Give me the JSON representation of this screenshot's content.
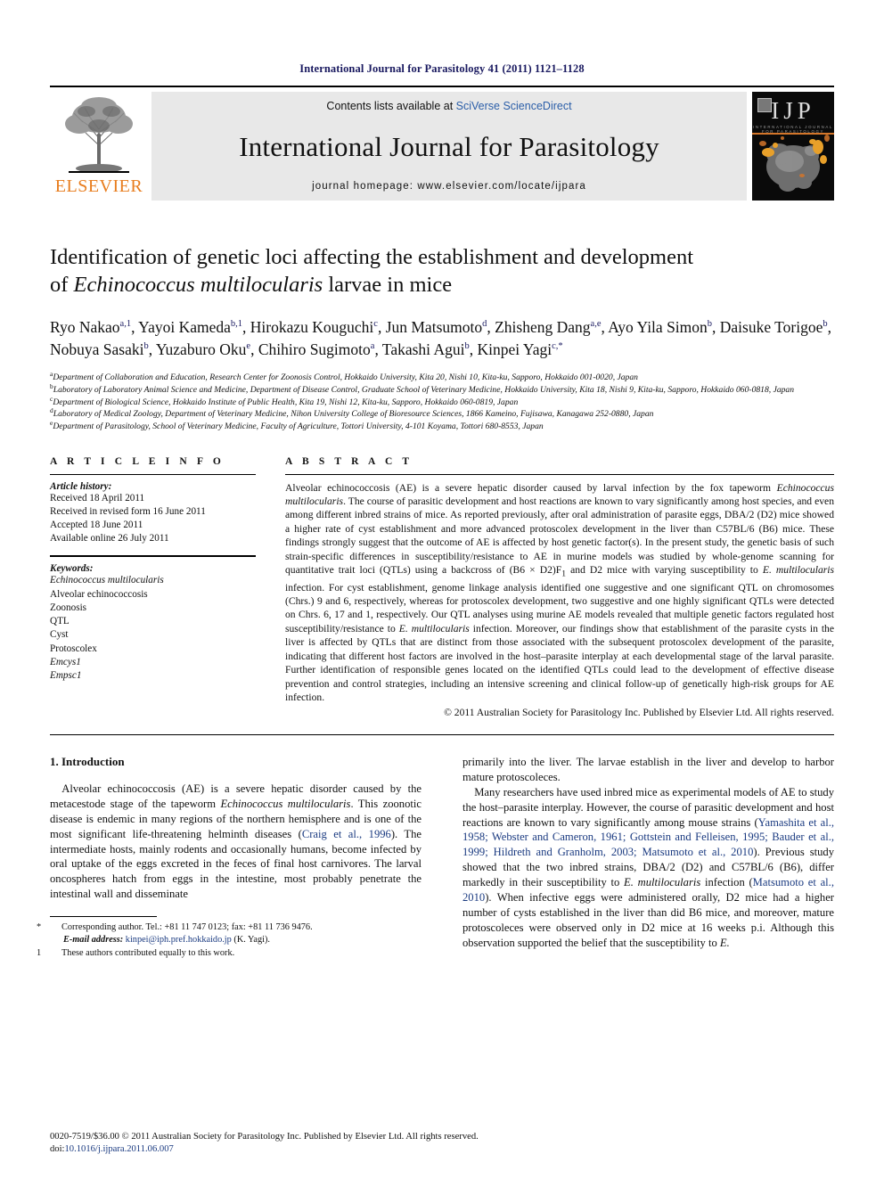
{
  "running_head": "International Journal for Parasitology 41 (2011) 1121–1128",
  "header": {
    "contents_prefix": "Contents lists available at ",
    "contents_link": "SciVerse ScienceDirect",
    "journal_title": "International Journal for Parasitology",
    "homepage_label": "journal homepage: www.elsevier.com/locate/ijpara",
    "elsevier_wordmark": "ELSEVIER",
    "cover_title": "IJP",
    "cover_subtitle": "INTERNATIONAL JOURNAL FOR PARASITOLOGY",
    "accent_color": "#e87d1e",
    "link_color": "#2b5ea8",
    "band_color": "#e8e8e8"
  },
  "article": {
    "title_line1": "Identification of genetic loci affecting the establishment and development",
    "title_line2_pre": "of ",
    "title_line2_italic": "Echinococcus multilocularis",
    "title_line2_post": " larvae in mice",
    "authors_html": "Ryo Nakao<sup>a,1</sup>, Yayoi Kameda<sup>b,1</sup>, Hirokazu Kouguchi<sup>c</sup>, Jun Matsumoto<sup>d</sup>, Zhisheng Dang<sup>a,e</sup>, Ayo Yila Simon<sup>b</sup>, Daisuke Torigoe<sup>b</sup>, Nobuya Sasaki<sup>b</sup>, Yuzaburo Oku<sup>e</sup>, Chihiro Sugimoto<sup>a</sup>, Takashi Agui<sup>b</sup>, Kinpei Yagi<sup>c,*</sup>",
    "affiliations": [
      {
        "marker": "a",
        "text": "Department of Collaboration and Education, Research Center for Zoonosis Control, Hokkaido University, Kita 20, Nishi 10, Kita-ku, Sapporo, Hokkaido 001-0020, Japan"
      },
      {
        "marker": "b",
        "text": "Laboratory of Laboratory Animal Science and Medicine, Department of Disease Control, Graduate School of Veterinary Medicine, Hokkaido University, Kita 18, Nishi 9, Kita-ku, Sapporo, Hokkaido 060-0818, Japan"
      },
      {
        "marker": "c",
        "text": "Department of Biological Science, Hokkaido Institute of Public Health, Kita 19, Nishi 12, Kita-ku, Sapporo, Hokkaido 060-0819, Japan"
      },
      {
        "marker": "d",
        "text": "Laboratory of Medical Zoology, Department of Veterinary Medicine, Nihon University College of Bioresource Sciences, 1866 Kameino, Fujisawa, Kanagawa 252-0880, Japan"
      },
      {
        "marker": "e",
        "text": "Department of Parasitology, School of Veterinary Medicine, Faculty of Agriculture, Tottori University, 4-101 Koyama, Tottori 680-8553, Japan"
      }
    ]
  },
  "article_info": {
    "heading": "A R T I C L E  I N F O",
    "history_label": "Article history:",
    "history": [
      "Received 18 April 2011",
      "Received in revised form 16 June 2011",
      "Accepted 18 June 2011",
      "Available online 26 July 2011"
    ],
    "keywords_label": "Keywords:",
    "keywords": [
      {
        "text": "Echinococcus multilocularis",
        "italic": true
      },
      {
        "text": "Alveolar echinococcosis",
        "italic": false
      },
      {
        "text": "Zoonosis",
        "italic": false
      },
      {
        "text": "QTL",
        "italic": false
      },
      {
        "text": "Cyst",
        "italic": false
      },
      {
        "text": "Protoscolex",
        "italic": false
      },
      {
        "text": "Emcys1",
        "italic": true
      },
      {
        "text": "Empsc1",
        "italic": true
      }
    ]
  },
  "abstract": {
    "heading": "A B S T R A C T",
    "body_html": "Alveolar echinococcosis (AE) is a severe hepatic disorder caused by larval infection by the fox tapeworm <span class=\"ital\">Echinococcus multilocularis</span>. The course of parasitic development and host reactions are known to vary significantly among host species, and even among different inbred strains of mice. As reported previously, after oral administration of parasite eggs, DBA/2 (D2) mice showed a higher rate of cyst establishment and more advanced protoscolex development in the liver than C57BL/6 (B6) mice. These findings strongly suggest that the outcome of AE is affected by host genetic factor(s). In the present study, the genetic basis of such strain-specific differences in susceptibility/resistance to AE in murine models was studied by whole-genome scanning for quantitative trait loci (QTLs) using a backcross of (B6 &#215; D2)F<sub>1</sub> and D2 mice with varying susceptibility to <span class=\"ital\">E. multilocularis</span> infection. For cyst establishment, genome linkage analysis identified one suggestive and one significant QTL on chromosomes (Chrs.) 9 and 6, respectively, whereas for protoscolex development, two suggestive and one highly significant QTLs were detected on Chrs. 6, 17 and 1, respectively. Our QTL analyses using murine AE models revealed that multiple genetic factors regulated host susceptibility/resistance to <span class=\"ital\">E. multilocularis</span> infection. Moreover, our findings show that establishment of the parasite cysts in the liver is affected by QTLs that are distinct from those associated with the subsequent protoscolex development of the parasite, indicating that different host factors are involved in the host–parasite interplay at each developmental stage of the larval parasite. Further identification of responsible genes located on the identified QTLs could lead to the development of effective disease prevention and control strategies, including an intensive screening and clinical follow-up of genetically high-risk groups for AE infection.",
    "copyright": "© 2011 Australian Society for Parasitology Inc. Published by Elsevier Ltd. All rights reserved."
  },
  "introduction": {
    "heading": "1. Introduction",
    "left_paragraphs_html": [
      "Alveolar echinococcosis (AE) is a severe hepatic disorder caused by the metacestode stage of the tapeworm <span class=\"ital\">Echinococcus multilocularis</span>. This zoonotic disease is endemic in many regions of the northern hemisphere and is one of the most significant life-threatening helminth diseases (<span class=\"ref\">Craig et al., 1996</span>). The intermediate hosts, mainly rodents and occasionally humans, become infected by oral uptake of the eggs excreted in the feces of final host carnivores. The larval oncospheres hatch from eggs in the intestine, most probably penetrate the intestinal wall and disseminate"
    ],
    "right_paragraphs_html": [
      "primarily into the liver. The larvae establish in the liver and develop to harbor mature protoscoleces.",
      "Many researchers have used inbred mice as experimental models of AE to study the host–parasite interplay. However, the course of parasitic development and host reactions are known to vary significantly among mouse strains (<span class=\"ref\">Yamashita et al., 1958; Webster and Cameron, 1961; Gottstein and Felleisen, 1995; Bauder et al., 1999; Hildreth and Granholm, 2003; Matsumoto et al., 2010</span>). Previous study showed that the two inbred strains, DBA/2 (D2) and C57BL/6 (B6), differ markedly in their susceptibility to <span class=\"ital\">E. multilocularis</span> infection (<span class=\"ref\">Matsumoto et al., 2010</span>). When infective eggs were administered orally, D2 mice had a higher number of cysts established in the liver than did B6 mice, and moreover, mature protoscoleces were observed only in D2 mice at 16 weeks p.i. Although this observation supported the belief that the susceptibility to <span class=\"ital\">E.</span>"
    ]
  },
  "footnotes": {
    "corresponding_marker": "*",
    "corresponding_text": "Corresponding author. Tel.: +81 11 747 0123; fax: +81 11 736 9476.",
    "email_label": "E-mail address:",
    "email_address": "kinpei@iph.pref.hokkaido.jp",
    "email_attrib": "(K. Yagi).",
    "equal_marker": "1",
    "equal_text": "These authors contributed equally to this work."
  },
  "imprint": {
    "line1": "0020-7519/$36.00 © 2011 Australian Society for Parasitology Inc. Published by Elsevier Ltd. All rights reserved.",
    "doi_label": "doi:",
    "doi_value": "10.1016/j.ijpara.2011.06.007"
  }
}
